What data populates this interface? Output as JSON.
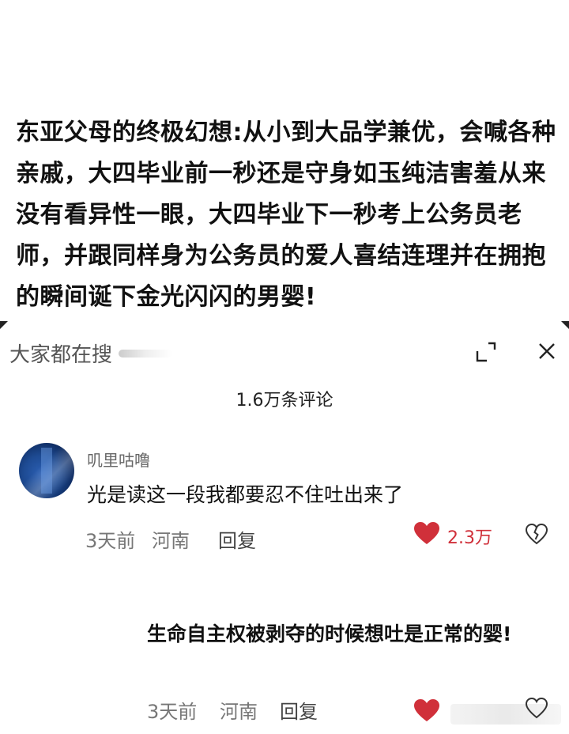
{
  "post": {
    "text": "东亚父母的终极幻想:从小到大品学兼优，会喊各种亲戚，大四毕业前一秒还是守身如玉纯洁害羞从来没有看异性一眼，大四毕业下一秒考上公务员老师，并跟同样身为公务员的爱人喜结连理并在拥抱的瞬间诞下金光闪闪的男婴!"
  },
  "search": {
    "text": "大家都在搜"
  },
  "comments_header": {
    "count_label": "1.6万条评论"
  },
  "comments": [
    {
      "username": "叽里咕噜",
      "text": "光是读这一段我都要忍不住吐出来了",
      "time": "3天前",
      "location": "河南",
      "reply_label": "回复",
      "likes": "2.3万"
    },
    {
      "text": "生命自主权被剥夺的时候想吐是正常的婴!",
      "time": "3天前",
      "location": "河南",
      "reply_label": "回复"
    }
  ],
  "colors": {
    "like_red": "#d0303a",
    "avatar_blue": "#1d4a92"
  },
  "icons": [
    "expand-icon",
    "close-icon",
    "heart-icon",
    "broken-heart-icon"
  ]
}
